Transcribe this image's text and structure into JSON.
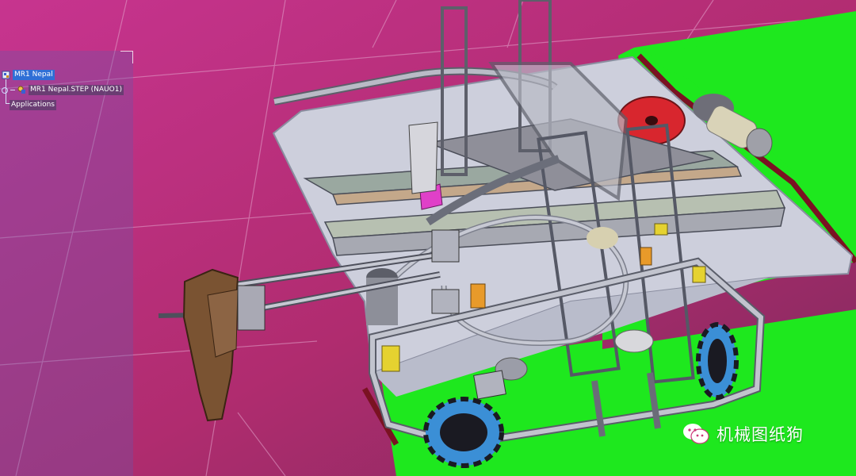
{
  "tree": {
    "root": {
      "label": "MR1 Nepal"
    },
    "child": {
      "label": "MR1 Nepal.STEP (NAUO1)"
    },
    "applications": {
      "label": "Applications"
    }
  },
  "watermark": {
    "text": "机械图纸狗",
    "icon": "wechat-icon"
  },
  "colors": {
    "background_top": "#c5328a",
    "background_bottom": "#8a2a66",
    "floor_green": "#1ee81e",
    "boundary_dark_red": "#7a1222",
    "base_plate": "#c9cbd9",
    "frame_steel": "#a8acb8",
    "wheel_blue": "#3b8fd6",
    "wood_part": "#7a5332",
    "disc_red": "#d8262e",
    "selection_blue": "#2f6fd6"
  }
}
